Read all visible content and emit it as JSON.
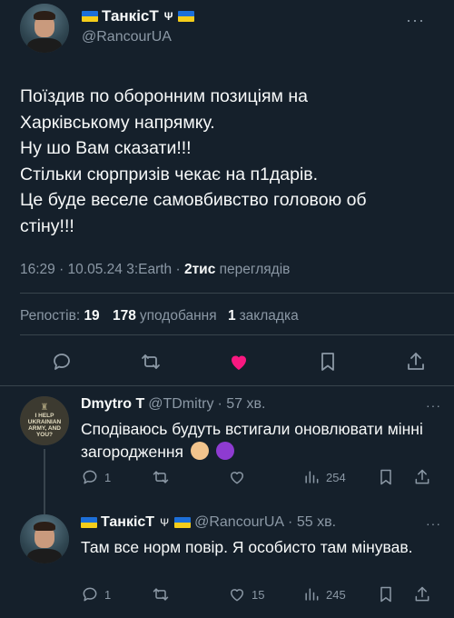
{
  "author": {
    "display_name": "ТанкісТ",
    "handle": "@RancourUA"
  },
  "tweet": {
    "text": "Поїздив по оборонним позиціям на\nХарківському напрямку.\nНу шо Вам сказати!!!\nСтільки сюрпризів чекає на п1дарів.\nЦе буде веселе самовбивство головою об\nстіну!!!",
    "meta_prefix": "16:29 · 10.05.24 3:Earth · ",
    "views_count": "2тис",
    "views_label": "переглядів"
  },
  "stats": {
    "reposts_label": "Репостів:",
    "reposts_count": "19",
    "likes_count": "178",
    "likes_label": "уподобання",
    "bookmarks_count": "1",
    "bookmarks_label": "закладка"
  },
  "replies": [
    {
      "name": "Dmytro T",
      "handle": "@TDmitry",
      "time": "· 57 хв.",
      "avatar_text": "I HELP UKRAINIAN ARMY, AND YOU?",
      "text": "Сподіваюсь будуть встигали оновлювати мінні загородження",
      "emojis": [
        "flexed-biceps-emoji",
        "smiling-imp-emoji"
      ],
      "replies_count": "1",
      "reposts_count": "",
      "likes_count": "",
      "views_count": "254"
    },
    {
      "name": "ТанкісТ",
      "handle": "@RancourUA",
      "time": "· 55 хв.",
      "text": "Там все норм повір. Я особисто там мінував.",
      "replies_count": "1",
      "reposts_count": "",
      "likes_count": "15",
      "views_count": "245"
    }
  ],
  "colors": {
    "background": "#15202b",
    "like_active": "#f91880",
    "muted_text": "#8b98a5",
    "divider": "#38444d"
  }
}
